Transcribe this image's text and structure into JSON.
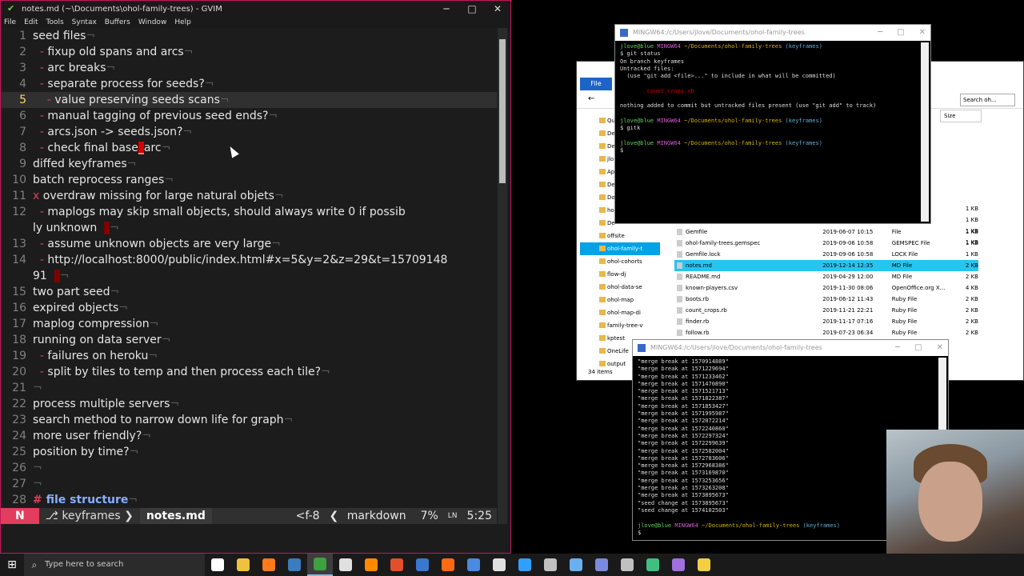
{
  "gvim": {
    "title": "notes.md (~\\Documents\\ohol-family-trees) - GVIM",
    "menu": [
      "File",
      "Edit",
      "Tools",
      "Syntax",
      "Buffers",
      "Window",
      "Help"
    ],
    "lines": [
      {
        "n": "1",
        "text": "seed files"
      },
      {
        "n": "2",
        "text": "  - fixup old spans and arcs"
      },
      {
        "n": "3",
        "text": "  - arc breaks"
      },
      {
        "n": "4",
        "text": "  - separate process for seeds?"
      },
      {
        "n": "5",
        "text": "    - value preserving seeds scans"
      },
      {
        "n": "6",
        "text": "  - manual tagging of previous seed ends?"
      },
      {
        "n": "7",
        "text": "  - arcs.json -> seeds.json?"
      },
      {
        "n": "8",
        "text": "  - check final base_arc"
      },
      {
        "n": "9",
        "text": "diffed keyframes"
      },
      {
        "n": "10",
        "text": "batch reprocess ranges"
      },
      {
        "n": "11",
        "text": "x overdraw missing for large natural objets"
      },
      {
        "n": "12",
        "text": "  - maplogs may skip small objects, should always write 0 if possib"
      },
      {
        "n": "",
        "text": "ly unknown"
      },
      {
        "n": "13",
        "text": "  - assume unknown objects are very large"
      },
      {
        "n": "14",
        "text": "  - http://localhost:8000/public/index.html#x=5&y=2&z=29&t=15709148"
      },
      {
        "n": "",
        "text": "91"
      },
      {
        "n": "15",
        "text": "two part seed"
      },
      {
        "n": "16",
        "text": "expired objects"
      },
      {
        "n": "17",
        "text": "maplog compression"
      },
      {
        "n": "18",
        "text": "running on data server"
      },
      {
        "n": "19",
        "text": "  - failures on heroku"
      },
      {
        "n": "20",
        "text": "  - split by tiles to temp and then process each tile?"
      },
      {
        "n": "21",
        "text": ""
      },
      {
        "n": "22",
        "text": "process multiple servers"
      },
      {
        "n": "23",
        "text": "search method to narrow down life for graph"
      },
      {
        "n": "24",
        "text": "more user friendly?"
      },
      {
        "n": "25",
        "text": "position by time?"
      },
      {
        "n": "26",
        "text": ""
      },
      {
        "n": "27",
        "text": ""
      },
      {
        "n": "28",
        "text": "# file structure"
      }
    ],
    "status": {
      "mode": "N",
      "branch": "keyframes",
      "file": "notes.md",
      "encoding": "<f-8",
      "filetype": "markdown",
      "percent": "7%",
      "ln_icon": "LN",
      "position": "5:25"
    }
  },
  "term1": {
    "title": "MINGW64:/c/Users/jlove/Documents/ohol-family-trees",
    "lines": [
      {
        "prompt_user": "jlove@blue",
        "prompt_env": "MINGW64",
        "prompt_path": "~/Documents/ohol-family-trees",
        "prompt_branch": "(keyframes)"
      },
      {
        "text": "$ git status"
      },
      {
        "text": "On branch keyframes"
      },
      {
        "text": "Untracked files:"
      },
      {
        "text": "  (use \"git add <file>...\" to include in what will be committed)"
      },
      {
        "text": ""
      },
      {
        "text": "        count_crops.rb",
        "color": "red"
      },
      {
        "text": ""
      },
      {
        "text": "nothing added to commit but untracked files present (use \"git add\" to track)"
      },
      {
        "text": ""
      },
      {
        "prompt_user": "jlove@blue",
        "prompt_env": "MINGW64",
        "prompt_path": "~/Documents/ohol-family-trees",
        "prompt_branch": "(keyframes)"
      },
      {
        "text": "$ gitk"
      },
      {
        "text": ""
      },
      {
        "prompt_user": "jlove@blue",
        "prompt_env": "MINGW64",
        "prompt_path": "~/Documents/ohol-family-trees",
        "prompt_branch": "(keyframes)"
      },
      {
        "text": "$ "
      }
    ]
  },
  "explorer": {
    "file_tab": "File",
    "search_placeholder": "Search oh...",
    "size_header": "Size",
    "tree": [
      "Qui",
      "De",
      "De",
      "jlo",
      "Ap",
      "De",
      "Do",
      "ho",
      "De",
      "offsite",
      "ohol-family-t",
      "ohol-cohorts",
      "flow-dj",
      "ohol-data-se",
      "ohol-map",
      "ohol-map-di",
      "family-tree-v",
      "kptest",
      "OneLife",
      "output"
    ],
    "tree_selected_index": 10,
    "files": [
      {
        "name": "Gemfile",
        "date": "2019-06-07 10:15",
        "type": "File",
        "size": "1 KB"
      },
      {
        "name": "ohol-family-trees.gemspec",
        "date": "2019-09-06 10:58",
        "type": "GEMSPEC File",
        "size": "1 KB"
      },
      {
        "name": "Gemfile.lock",
        "date": "2019-09-06 10:58",
        "type": "LOCK File",
        "size": "1 KB"
      },
      {
        "name": "notes.md",
        "date": "2019-12-14 12:35",
        "type": "MD File",
        "size": "2 KB",
        "selected": true
      },
      {
        "name": "README.md",
        "date": "2019-04-29 12:00",
        "type": "MD File",
        "size": "2 KB"
      },
      {
        "name": "known-players.csv",
        "date": "2019-11-30 08:06",
        "type": "OpenOffice.org X...",
        "size": "4 KB"
      },
      {
        "name": "boots.rb",
        "date": "2019-06-12 11:43",
        "type": "Ruby File",
        "size": "2 KB"
      },
      {
        "name": "count_crops.rb",
        "date": "2019-11-21 22:21",
        "type": "Ruby File",
        "size": "2 KB"
      },
      {
        "name": "finder.rb",
        "date": "2019-11-17 07:16",
        "type": "Ruby File",
        "size": "2 KB"
      },
      {
        "name": "follow.rb",
        "date": "2019-07-23 06:34",
        "type": "Ruby File",
        "size": "2 KB"
      }
    ],
    "extra_sizes": [
      "1 KB",
      "1 KB",
      "1 KB",
      "1 KB"
    ],
    "status": "34 items"
  },
  "term2": {
    "title": "MINGW64:/c/Users/jlove/Documents/ohol-family-trees",
    "lines": [
      "\"merge break at 1570914889\"",
      "\"merge break at 1571229694\"",
      "\"merge break at 1571233462\"",
      "\"merge break at 1571470890\"",
      "\"merge break at 1571521713\"",
      "\"merge break at 1571822387\"",
      "\"merge break at 1571853427\"",
      "\"merge break at 1571995987\"",
      "\"merge break at 1572072214\"",
      "\"merge break at 1572240860\"",
      "\"merge break at 1572297324\"",
      "\"merge break at 1572299639\"",
      "\"merge break at 1572582004\"",
      "\"merge break at 1572783606\"",
      "\"merge break at 1572968386\"",
      "\"merge break at 1573169870\"",
      "\"merge break at 1573253656\"",
      "\"merge break at 1573263208\"",
      "\"merge break at 1573895673\"",
      "\"seed change at 1573895673\"",
      "\"seed change at 1574102503\""
    ],
    "prompt": {
      "user": "jlove@blue",
      "env": "MINGW64",
      "path": "~/Documents/ohol-family-trees",
      "branch": "(keyframes)",
      "cmd": "$ "
    }
  },
  "taskbar": {
    "search_placeholder": "Type here to search",
    "icons": [
      {
        "name": "task-view-icon",
        "color": "#ffffff"
      },
      {
        "name": "file-explorer-icon",
        "color": "#f0c040"
      },
      {
        "name": "firefox-icon",
        "color": "#ff7a1a"
      },
      {
        "name": "steam-icon",
        "color": "#3b7bbf"
      },
      {
        "name": "gvim-icon",
        "color": "#3fa03f",
        "active": true
      },
      {
        "name": "notepad-icon",
        "color": "#e0e0e0"
      },
      {
        "name": "sublime-icon",
        "color": "#ff8a00"
      },
      {
        "name": "git-icon",
        "color": "#e0502c"
      },
      {
        "name": "terminal-icon",
        "color": "#3a78d0"
      },
      {
        "name": "app-icon-orange",
        "color": "#ff6a10"
      },
      {
        "name": "app-icon-blue",
        "color": "#4a8ae0"
      },
      {
        "name": "inkscape-icon",
        "color": "#e0e0e0"
      },
      {
        "name": "chrome-icon",
        "color": "#30a0ff"
      },
      {
        "name": "github-icon",
        "color": "#c0c0c0"
      },
      {
        "name": "paint-icon",
        "color": "#6ab0f0"
      },
      {
        "name": "discord-icon",
        "color": "#7a8ae0"
      },
      {
        "name": "app-icon-gray",
        "color": "#c0c0c0"
      },
      {
        "name": "app-icon-green",
        "color": "#40c080"
      },
      {
        "name": "app-icon-purple",
        "color": "#a070e0"
      },
      {
        "name": "git-gui-icon",
        "color": "#f0d040"
      }
    ]
  }
}
